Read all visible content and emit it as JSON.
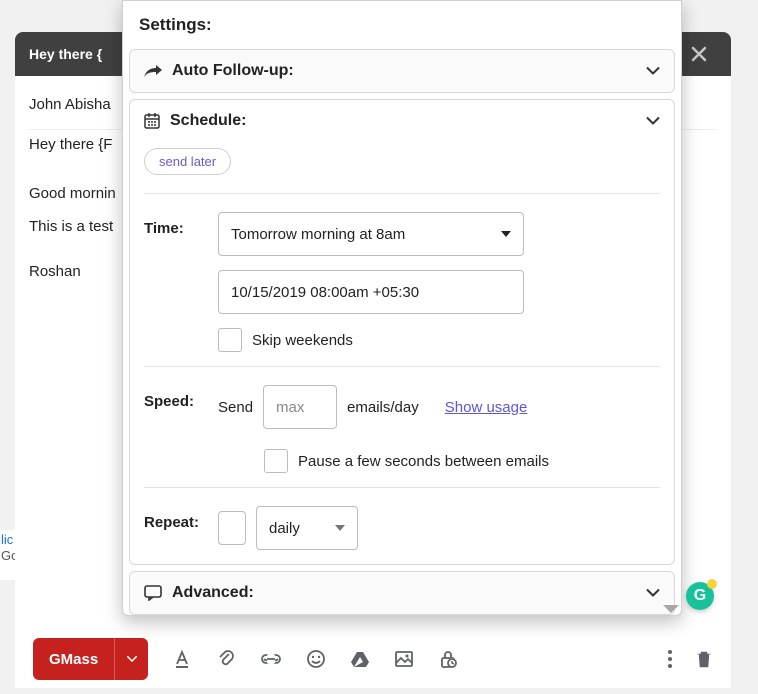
{
  "compose": {
    "subject": "Hey there {",
    "to_name": "John Abisha",
    "greeting_line": "Hey there {F",
    "body_line1": "Good mornin",
    "body_line2": "This is a test",
    "signature": "Roshan"
  },
  "settings": {
    "title": "Settings:",
    "autofollowup_label": "Auto Follow-up:",
    "schedule_label": "Schedule:",
    "advanced_label": "Advanced:",
    "send_later_chip": "send later",
    "time_label": "Time:",
    "time_preset": "Tomorrow morning at 8am",
    "time_value": "10/15/2019 08:00am +05:30",
    "skip_weekends_label": "Skip weekends",
    "speed_label": "Speed:",
    "speed_send_label": "Send",
    "speed_input_placeholder": "max",
    "speed_unit_label": "emails/day",
    "show_usage_link": "Show usage",
    "pause_label": "Pause a few seconds between emails",
    "repeat_label": "Repeat:",
    "repeat_freq": "daily"
  },
  "toolbar": {
    "gmass_label": "GMass"
  },
  "left_fragment": {
    "l1": "lic",
    "l2": "Go"
  },
  "grammarly_glyph": "G"
}
